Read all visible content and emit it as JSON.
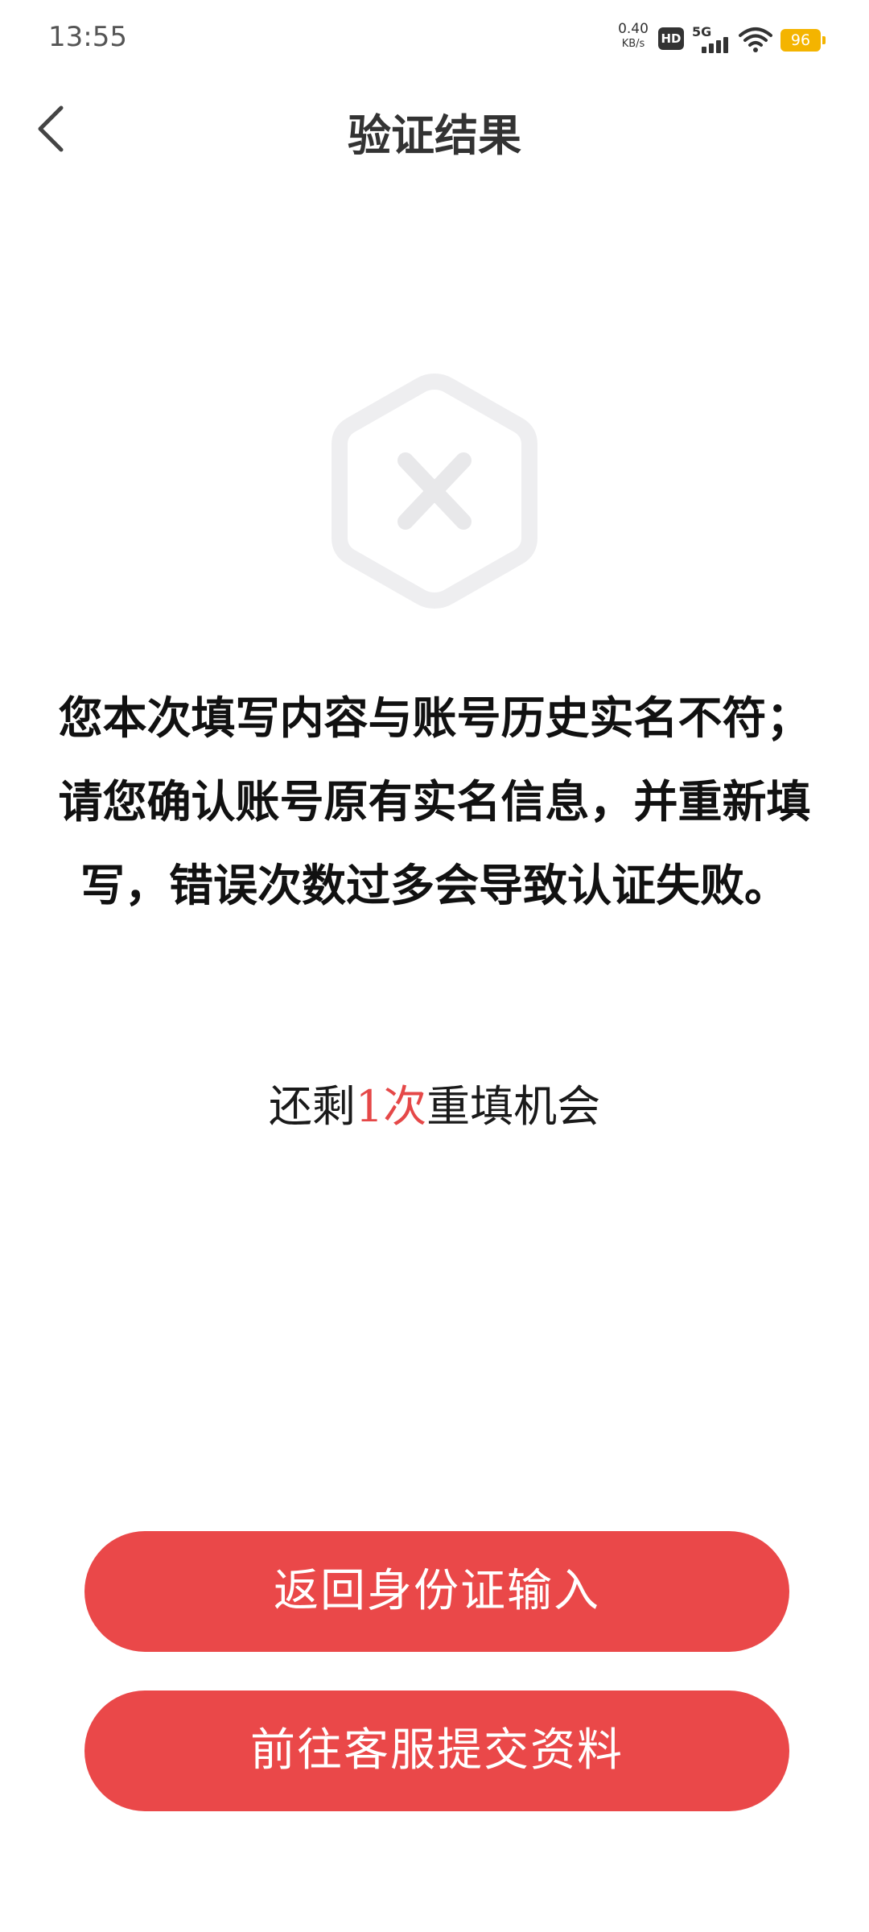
{
  "status_bar": {
    "time": "13:55",
    "net_speed_value": "0.40",
    "net_speed_unit": "KB/s",
    "hd_label": "HD",
    "network_type": "5G",
    "battery_level": "96",
    "battery_color": "#f4b400"
  },
  "header": {
    "title": "验证结果",
    "back_icon": "chevron-left-icon"
  },
  "main": {
    "result_icon": "hexagon-x-icon",
    "message": "您本次填写内容与账号历史实名不符；请您确认账号原有实名信息，并重新填写，错误次数过多会导致认证失败。",
    "retry_prefix": "还剩",
    "retry_count": "1次",
    "retry_suffix": "重填机会",
    "highlight_color": "#e54848"
  },
  "actions": {
    "back_to_id_label": "返回身份证输入",
    "contact_service_label": "前往客服提交资料",
    "button_color": "#ea4849"
  }
}
